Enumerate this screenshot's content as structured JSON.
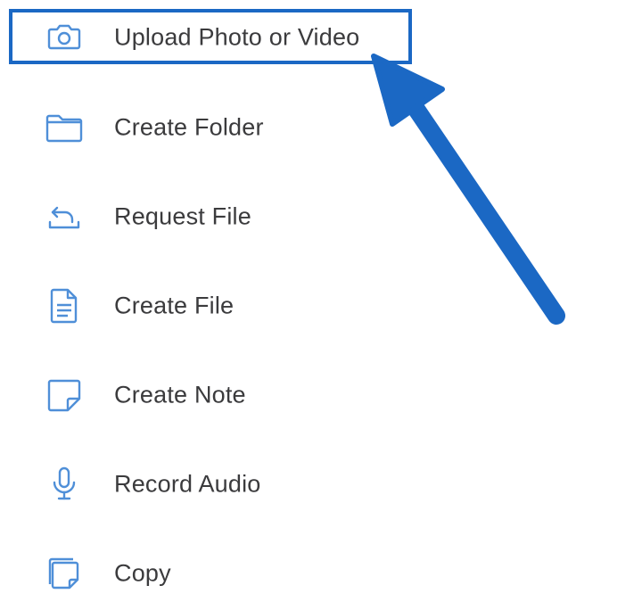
{
  "menu": {
    "items": [
      {
        "id": "upload",
        "label": "Upload Photo or Video",
        "icon": "camera-icon"
      },
      {
        "id": "create-folder",
        "label": "Create Folder",
        "icon": "folder-icon"
      },
      {
        "id": "request-file",
        "label": "Request File",
        "icon": "request-file-icon"
      },
      {
        "id": "create-file",
        "label": "Create File",
        "icon": "document-icon"
      },
      {
        "id": "create-note",
        "label": "Create Note",
        "icon": "note-icon"
      },
      {
        "id": "record-audio",
        "label": "Record Audio",
        "icon": "microphone-icon"
      },
      {
        "id": "copy",
        "label": "Copy",
        "icon": "copy-icon"
      }
    ]
  },
  "colors": {
    "icon": "#4f8fd8",
    "label": "#3b3b3d",
    "annotation": "#1b68c4"
  }
}
